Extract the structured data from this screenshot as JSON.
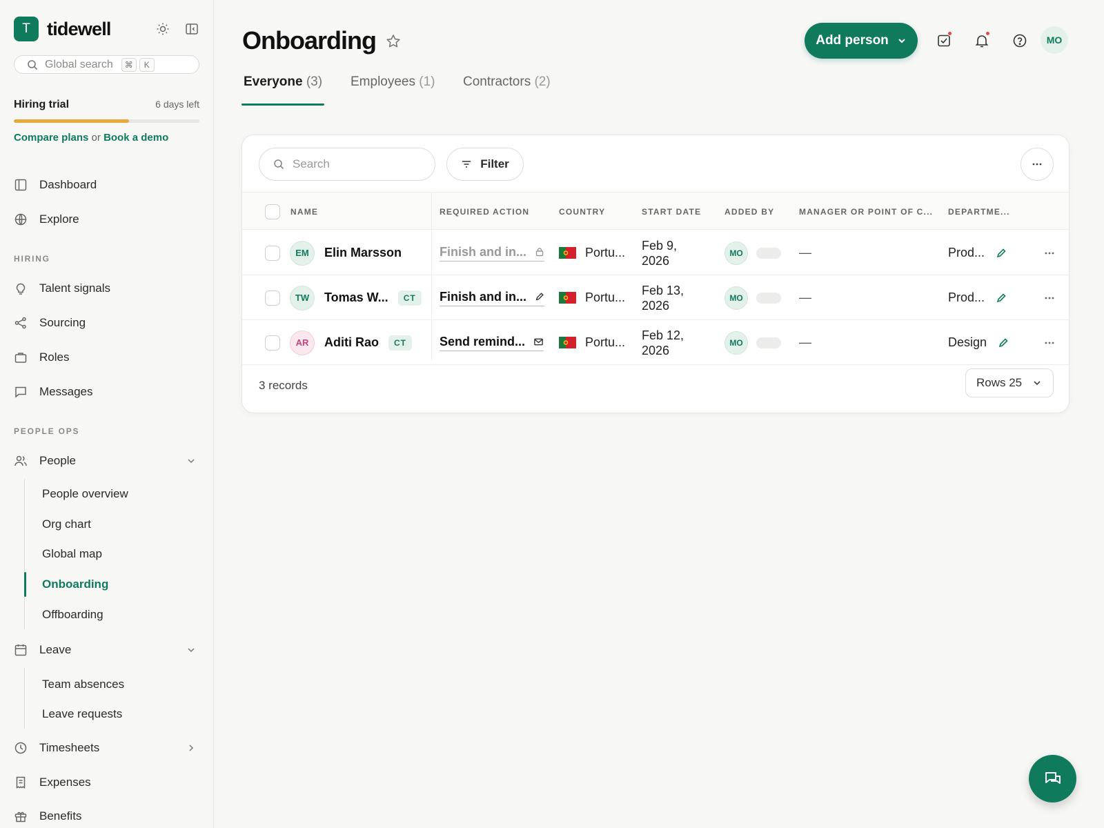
{
  "brand": {
    "initial": "T",
    "name": "tidewell"
  },
  "sidebar": {
    "search_placeholder": "Global search",
    "shortcut": [
      "⌘",
      "K"
    ],
    "trial": {
      "title": "Hiring trial",
      "days_left": "6 days left",
      "progress": 0.62,
      "link_compare": "Compare plans",
      "or": "or",
      "link_demo": "Book a demo"
    },
    "items_top": [
      {
        "label": "Dashboard",
        "icon": "dashboard-icon"
      },
      {
        "label": "Explore",
        "icon": "globe-icon"
      }
    ],
    "section_hiring": "HIRING",
    "items_hiring": [
      {
        "label": "Talent signals",
        "icon": "lightbulb-icon"
      },
      {
        "label": "Sourcing",
        "icon": "share-icon"
      },
      {
        "label": "Roles",
        "icon": "briefcase-icon"
      },
      {
        "label": "Messages",
        "icon": "message-icon"
      }
    ],
    "section_people_ops": "PEOPLE OPS",
    "people": {
      "label": "People",
      "icon": "people-icon"
    },
    "people_sub": [
      "People overview",
      "Org chart",
      "Global map",
      "Onboarding",
      "Offboarding"
    ],
    "people_active": "Onboarding",
    "leave": {
      "label": "Leave",
      "icon": "calendar-icon"
    },
    "leave_sub": [
      "Team absences",
      "Leave requests"
    ],
    "items_bottom": [
      {
        "label": "Timesheets",
        "icon": "clock-icon"
      },
      {
        "label": "Expenses",
        "icon": "receipt-icon"
      },
      {
        "label": "Benefits",
        "icon": "gift-icon"
      }
    ]
  },
  "header": {
    "title": "Onboarding",
    "add_button": "Add person",
    "user_initials": "MO"
  },
  "tabs": [
    {
      "label": "Everyone",
      "count": "(3)",
      "active": true
    },
    {
      "label": "Employees",
      "count": "(1)",
      "active": false
    },
    {
      "label": "Contractors",
      "count": "(2)",
      "active": false
    }
  ],
  "table": {
    "search_placeholder": "Search",
    "filter_label": "Filter",
    "columns": [
      "NAME",
      "REQUIRED ACTION",
      "COUNTRY",
      "START DATE",
      "ADDED BY",
      "MANAGER OR POINT OF C...",
      "DEPARTME..."
    ],
    "rows": [
      {
        "initials": "EM",
        "avatar_color": "green",
        "name": "Elin Marsson",
        "badge": "",
        "action": "Finish and in...",
        "action_icon": "lock-icon",
        "action_muted": true,
        "country": "Portu...",
        "start_line1": "Feb 9,",
        "start_line2": "2026",
        "added_by": "MO",
        "manager": "—",
        "department": "Prod..."
      },
      {
        "initials": "TW",
        "avatar_color": "green",
        "name": "Tomas W...",
        "badge": "CT",
        "action": "Finish and in...",
        "action_icon": "pencil-icon",
        "action_muted": false,
        "country": "Portu...",
        "start_line1": "Feb 13,",
        "start_line2": "2026",
        "added_by": "MO",
        "manager": "—",
        "department": "Prod..."
      },
      {
        "initials": "AR",
        "avatar_color": "pink",
        "name": "Aditi Rao",
        "badge": "CT",
        "action": "Send remind...",
        "action_icon": "mail-icon",
        "action_muted": false,
        "country": "Portu...",
        "start_line1": "Feb 12,",
        "start_line2": "2026",
        "added_by": "MO",
        "manager": "—",
        "department": "Design"
      }
    ],
    "records_label": "3 records",
    "rows_per_page_label": "Rows 25"
  },
  "colors": {
    "brand": "#107a5c",
    "trial_bar": "#e8a83b",
    "notification_dot": "#e54848"
  }
}
